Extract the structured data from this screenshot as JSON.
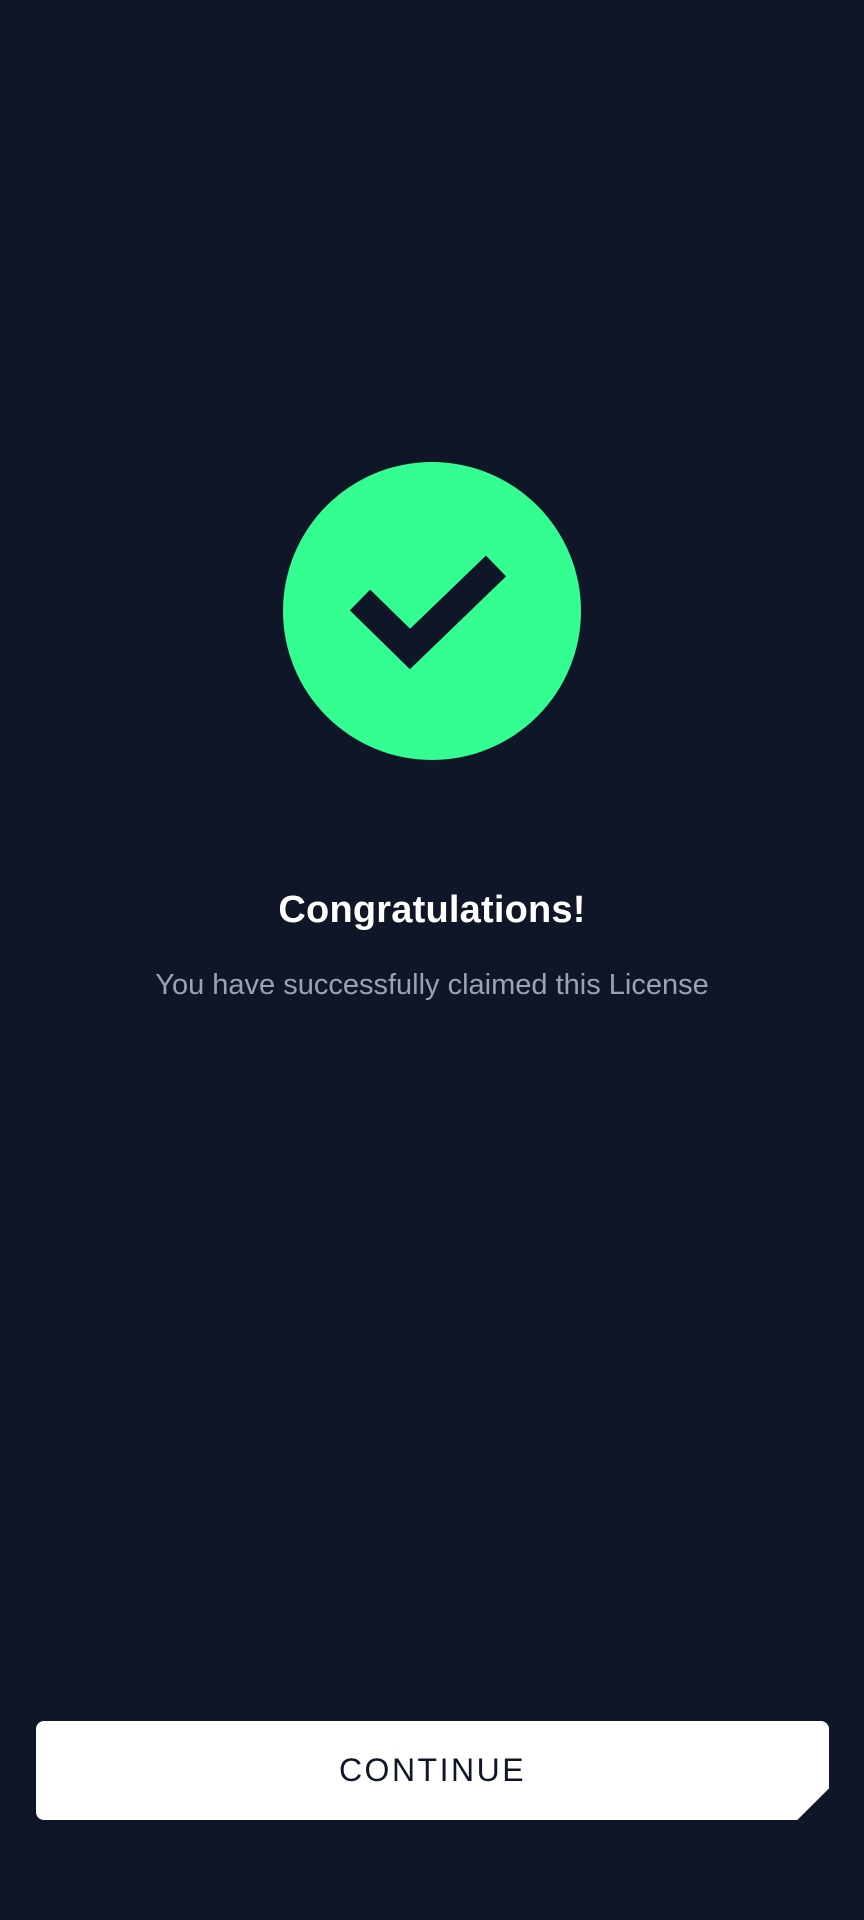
{
  "success": {
    "icon": "checkmark-icon",
    "color": "#34fe92"
  },
  "message": {
    "title": "Congratulations!",
    "subtitle": "You have successfully claimed this License"
  },
  "actions": {
    "continue_label": "CONTINUE"
  },
  "colors": {
    "background": "#0e1628",
    "accent": "#34fe92",
    "button": "#ffffff"
  }
}
